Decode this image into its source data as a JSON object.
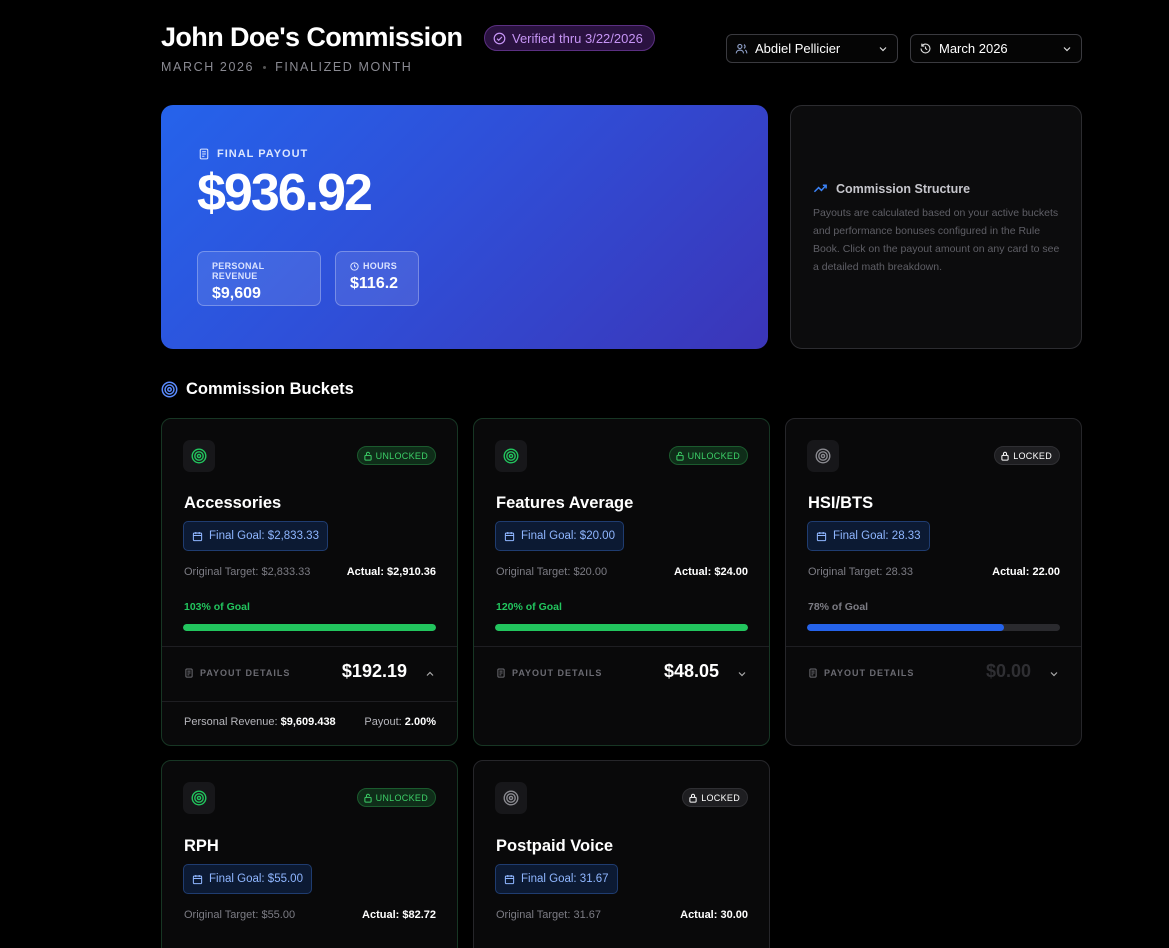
{
  "header": {
    "title": "John Doe's Commission",
    "verified": "Verified thru 3/22/2026",
    "month": "MARCH 2026",
    "status": "FINALIZED MONTH",
    "user_select": "Abdiel Pellicier",
    "month_select": "March 2026"
  },
  "payout": {
    "label": "FINAL PAYOUT",
    "amount": "$936.92",
    "revenue_label": "PERSONAL REVENUE",
    "revenue_value": "$9,609",
    "hours_label": "HOURS",
    "hours_value": "$116.2"
  },
  "structure": {
    "title": "Commission Structure",
    "text": "Payouts are calculated based on your active buckets and performance bonuses configured in the Rule Book. Click on the payout amount on any card to see a detailed math breakdown."
  },
  "buckets_section": {
    "title": "Commission Buckets"
  },
  "buckets": [
    {
      "name": "Accessories",
      "status": "UNLOCKED",
      "goal": "Final Goal: $2,833.33",
      "target": "Original Target: $2,833.33",
      "actual": "Actual: $2,910.36",
      "pct_label": "103% of Goal",
      "progress": 1.0,
      "details_label": "PAYOUT DETAILS",
      "payout": "$192.19",
      "breakdown_label": "Personal Revenue:",
      "breakdown_value": "$9,609.438",
      "rate_label": "Payout:",
      "rate_value": "2.00%"
    },
    {
      "name": "Features Average",
      "status": "UNLOCKED",
      "goal": "Final Goal: $20.00",
      "target": "Original Target: $20.00",
      "actual": "Actual: $24.00",
      "pct_label": "120% of Goal",
      "progress": 1.0,
      "details_label": "PAYOUT DETAILS",
      "payout": "$48.05"
    },
    {
      "name": "HSI/BTS",
      "status": "LOCKED",
      "goal": "Final Goal: 28.33",
      "target": "Original Target: 28.33",
      "actual": "Actual: 22.00",
      "pct_label": "78% of Goal",
      "progress": 0.78,
      "details_label": "PAYOUT DETAILS",
      "payout": "$0.00"
    },
    {
      "name": "RPH",
      "status": "UNLOCKED",
      "goal": "Final Goal: $55.00",
      "target": "Original Target: $55.00",
      "actual": "Actual: $82.72"
    },
    {
      "name": "Postpaid Voice",
      "status": "LOCKED",
      "goal": "Final Goal: 31.67",
      "target": "Original Target: 31.67",
      "actual": "Actual: 30.00"
    }
  ],
  "colors": {
    "accent_green": "#22c55e",
    "accent_blue": "#2563eb",
    "verified_purple": "#c694f5",
    "goal_blue": "#8fb6ff"
  }
}
